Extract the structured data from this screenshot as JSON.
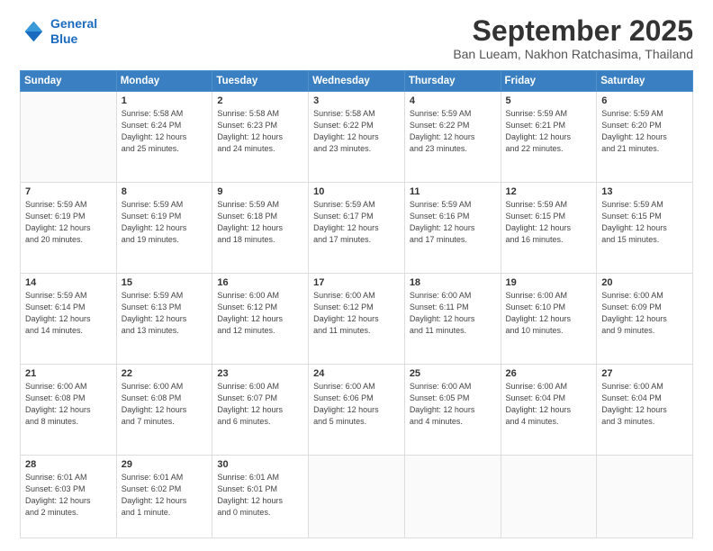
{
  "header": {
    "logo_line1": "General",
    "logo_line2": "Blue",
    "month": "September 2025",
    "location": "Ban Lueam, Nakhon Ratchasima, Thailand"
  },
  "weekdays": [
    "Sunday",
    "Monday",
    "Tuesday",
    "Wednesday",
    "Thursday",
    "Friday",
    "Saturday"
  ],
  "weeks": [
    [
      {
        "day": "",
        "lines": []
      },
      {
        "day": "1",
        "lines": [
          "Sunrise: 5:58 AM",
          "Sunset: 6:24 PM",
          "Daylight: 12 hours",
          "and 25 minutes."
        ]
      },
      {
        "day": "2",
        "lines": [
          "Sunrise: 5:58 AM",
          "Sunset: 6:23 PM",
          "Daylight: 12 hours",
          "and 24 minutes."
        ]
      },
      {
        "day": "3",
        "lines": [
          "Sunrise: 5:58 AM",
          "Sunset: 6:22 PM",
          "Daylight: 12 hours",
          "and 23 minutes."
        ]
      },
      {
        "day": "4",
        "lines": [
          "Sunrise: 5:59 AM",
          "Sunset: 6:22 PM",
          "Daylight: 12 hours",
          "and 23 minutes."
        ]
      },
      {
        "day": "5",
        "lines": [
          "Sunrise: 5:59 AM",
          "Sunset: 6:21 PM",
          "Daylight: 12 hours",
          "and 22 minutes."
        ]
      },
      {
        "day": "6",
        "lines": [
          "Sunrise: 5:59 AM",
          "Sunset: 6:20 PM",
          "Daylight: 12 hours",
          "and 21 minutes."
        ]
      }
    ],
    [
      {
        "day": "7",
        "lines": [
          "Sunrise: 5:59 AM",
          "Sunset: 6:19 PM",
          "Daylight: 12 hours",
          "and 20 minutes."
        ]
      },
      {
        "day": "8",
        "lines": [
          "Sunrise: 5:59 AM",
          "Sunset: 6:19 PM",
          "Daylight: 12 hours",
          "and 19 minutes."
        ]
      },
      {
        "day": "9",
        "lines": [
          "Sunrise: 5:59 AM",
          "Sunset: 6:18 PM",
          "Daylight: 12 hours",
          "and 18 minutes."
        ]
      },
      {
        "day": "10",
        "lines": [
          "Sunrise: 5:59 AM",
          "Sunset: 6:17 PM",
          "Daylight: 12 hours",
          "and 17 minutes."
        ]
      },
      {
        "day": "11",
        "lines": [
          "Sunrise: 5:59 AM",
          "Sunset: 6:16 PM",
          "Daylight: 12 hours",
          "and 17 minutes."
        ]
      },
      {
        "day": "12",
        "lines": [
          "Sunrise: 5:59 AM",
          "Sunset: 6:15 PM",
          "Daylight: 12 hours",
          "and 16 minutes."
        ]
      },
      {
        "day": "13",
        "lines": [
          "Sunrise: 5:59 AM",
          "Sunset: 6:15 PM",
          "Daylight: 12 hours",
          "and 15 minutes."
        ]
      }
    ],
    [
      {
        "day": "14",
        "lines": [
          "Sunrise: 5:59 AM",
          "Sunset: 6:14 PM",
          "Daylight: 12 hours",
          "and 14 minutes."
        ]
      },
      {
        "day": "15",
        "lines": [
          "Sunrise: 5:59 AM",
          "Sunset: 6:13 PM",
          "Daylight: 12 hours",
          "and 13 minutes."
        ]
      },
      {
        "day": "16",
        "lines": [
          "Sunrise: 6:00 AM",
          "Sunset: 6:12 PM",
          "Daylight: 12 hours",
          "and 12 minutes."
        ]
      },
      {
        "day": "17",
        "lines": [
          "Sunrise: 6:00 AM",
          "Sunset: 6:12 PM",
          "Daylight: 12 hours",
          "and 11 minutes."
        ]
      },
      {
        "day": "18",
        "lines": [
          "Sunrise: 6:00 AM",
          "Sunset: 6:11 PM",
          "Daylight: 12 hours",
          "and 11 minutes."
        ]
      },
      {
        "day": "19",
        "lines": [
          "Sunrise: 6:00 AM",
          "Sunset: 6:10 PM",
          "Daylight: 12 hours",
          "and 10 minutes."
        ]
      },
      {
        "day": "20",
        "lines": [
          "Sunrise: 6:00 AM",
          "Sunset: 6:09 PM",
          "Daylight: 12 hours",
          "and 9 minutes."
        ]
      }
    ],
    [
      {
        "day": "21",
        "lines": [
          "Sunrise: 6:00 AM",
          "Sunset: 6:08 PM",
          "Daylight: 12 hours",
          "and 8 minutes."
        ]
      },
      {
        "day": "22",
        "lines": [
          "Sunrise: 6:00 AM",
          "Sunset: 6:08 PM",
          "Daylight: 12 hours",
          "and 7 minutes."
        ]
      },
      {
        "day": "23",
        "lines": [
          "Sunrise: 6:00 AM",
          "Sunset: 6:07 PM",
          "Daylight: 12 hours",
          "and 6 minutes."
        ]
      },
      {
        "day": "24",
        "lines": [
          "Sunrise: 6:00 AM",
          "Sunset: 6:06 PM",
          "Daylight: 12 hours",
          "and 5 minutes."
        ]
      },
      {
        "day": "25",
        "lines": [
          "Sunrise: 6:00 AM",
          "Sunset: 6:05 PM",
          "Daylight: 12 hours",
          "and 4 minutes."
        ]
      },
      {
        "day": "26",
        "lines": [
          "Sunrise: 6:00 AM",
          "Sunset: 6:04 PM",
          "Daylight: 12 hours",
          "and 4 minutes."
        ]
      },
      {
        "day": "27",
        "lines": [
          "Sunrise: 6:00 AM",
          "Sunset: 6:04 PM",
          "Daylight: 12 hours",
          "and 3 minutes."
        ]
      }
    ],
    [
      {
        "day": "28",
        "lines": [
          "Sunrise: 6:01 AM",
          "Sunset: 6:03 PM",
          "Daylight: 12 hours",
          "and 2 minutes."
        ]
      },
      {
        "day": "29",
        "lines": [
          "Sunrise: 6:01 AM",
          "Sunset: 6:02 PM",
          "Daylight: 12 hours",
          "and 1 minute."
        ]
      },
      {
        "day": "30",
        "lines": [
          "Sunrise: 6:01 AM",
          "Sunset: 6:01 PM",
          "Daylight: 12 hours",
          "and 0 minutes."
        ]
      },
      {
        "day": "",
        "lines": []
      },
      {
        "day": "",
        "lines": []
      },
      {
        "day": "",
        "lines": []
      },
      {
        "day": "",
        "lines": []
      }
    ]
  ]
}
